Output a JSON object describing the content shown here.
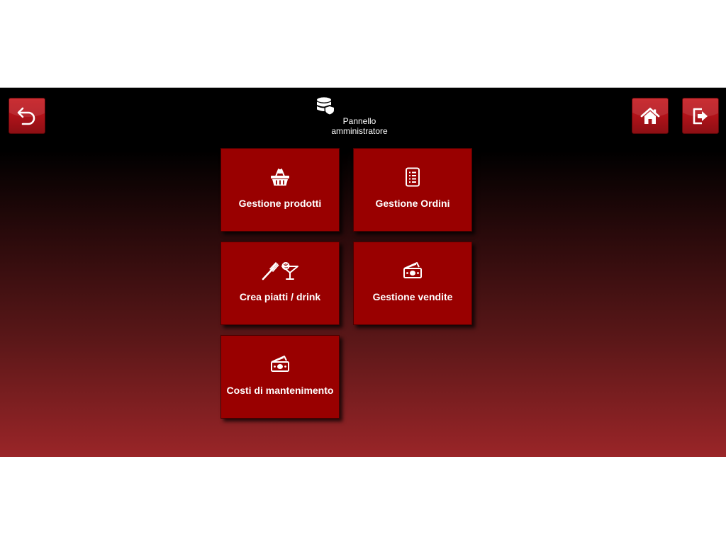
{
  "header": {
    "title": "Pannello\namministratore",
    "icon": "database-shield-icon"
  },
  "nav": {
    "back_icon": "undo-arrow-icon",
    "home_icon": "home-icon",
    "exit_icon": "logout-icon"
  },
  "tiles": [
    {
      "label": "Gestione prodotti",
      "icon": "basket-icon"
    },
    {
      "label": "Gestione Ordini",
      "icon": "list-document-icon"
    },
    {
      "label": "Crea piatti / drink",
      "icon": "fork-cocktail-icon"
    },
    {
      "label": "Gestione vendite",
      "icon": "money-icon"
    },
    {
      "label": "Costi di mantenimento",
      "icon": "money-icon"
    }
  ],
  "colors": {
    "tile": "#990000",
    "accent_button": "#b3131a",
    "text": "#ffffff",
    "gradient_top": "#000000",
    "gradient_bottom": "#9a2528"
  }
}
